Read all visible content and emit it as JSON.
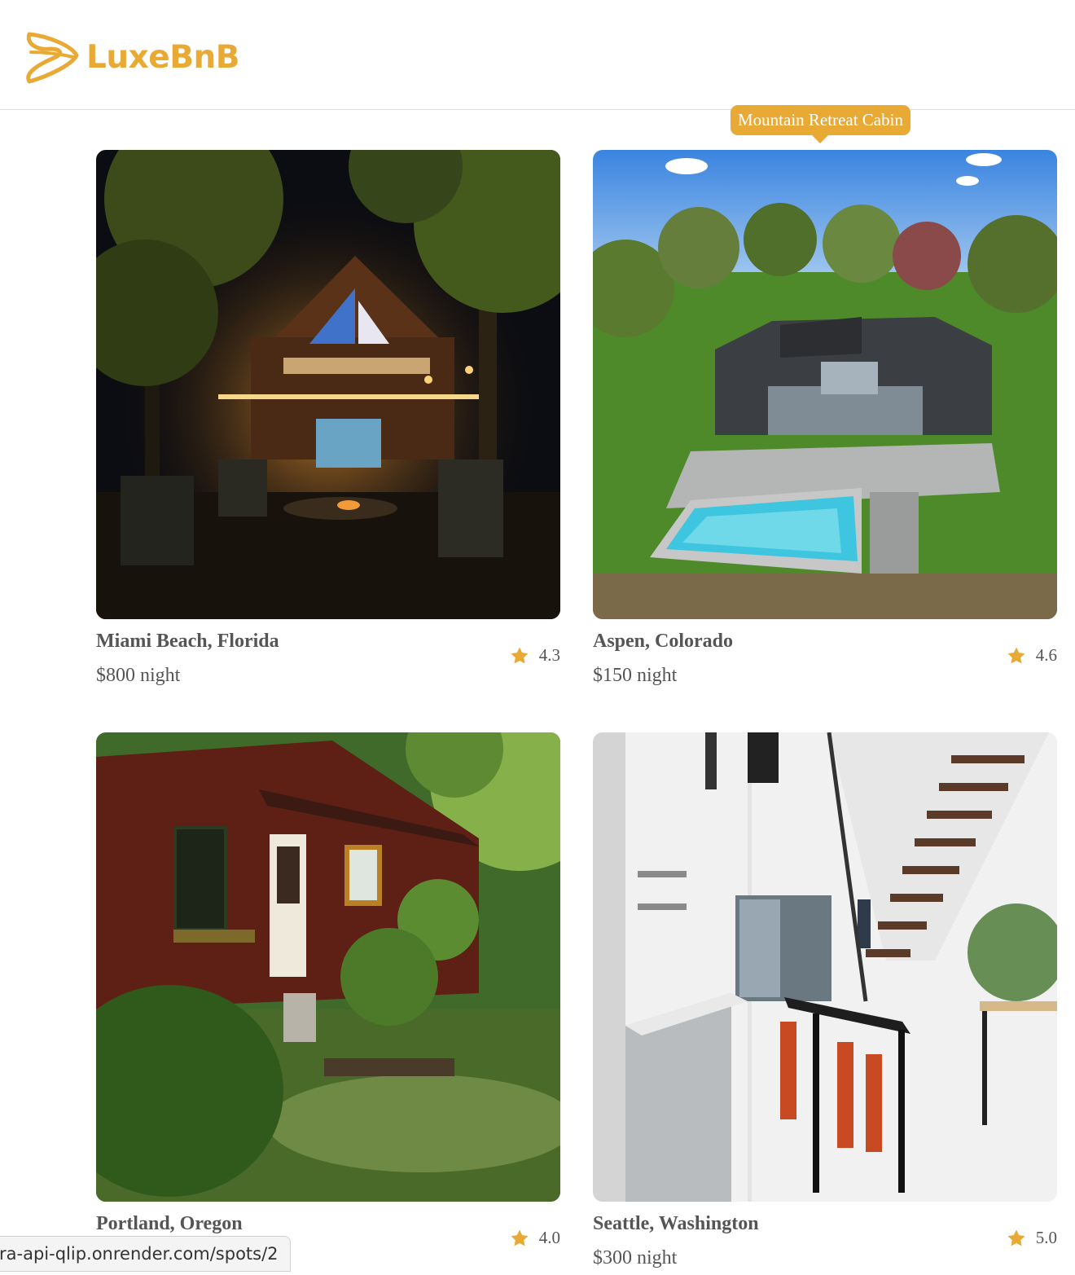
{
  "brand": {
    "name": "LuxeBnB",
    "color": "#E9AA35",
    "icon": "logo-loop-icon"
  },
  "tooltip": {
    "text": "Mountain Retreat Cabin"
  },
  "listings": [
    {
      "location": "Miami Beach, Florida",
      "price": "$800 night",
      "rating": "4.3",
      "photo": "night-cabin-photo"
    },
    {
      "location": "Aspen, Colorado",
      "price": "$150 night",
      "rating": "4.6",
      "photo": "modern-house-pool-photo"
    },
    {
      "location": "Portland, Oregon",
      "price": "",
      "rating": "4.0",
      "photo": "red-cabin-garden-photo"
    },
    {
      "location": "Seattle, Washington",
      "price": "$300 night",
      "rating": "5.0",
      "photo": "loft-kitchen-photo"
    }
  ],
  "status_bar": {
    "url": "ra-api-qlip.onrender.com/spots/2"
  }
}
